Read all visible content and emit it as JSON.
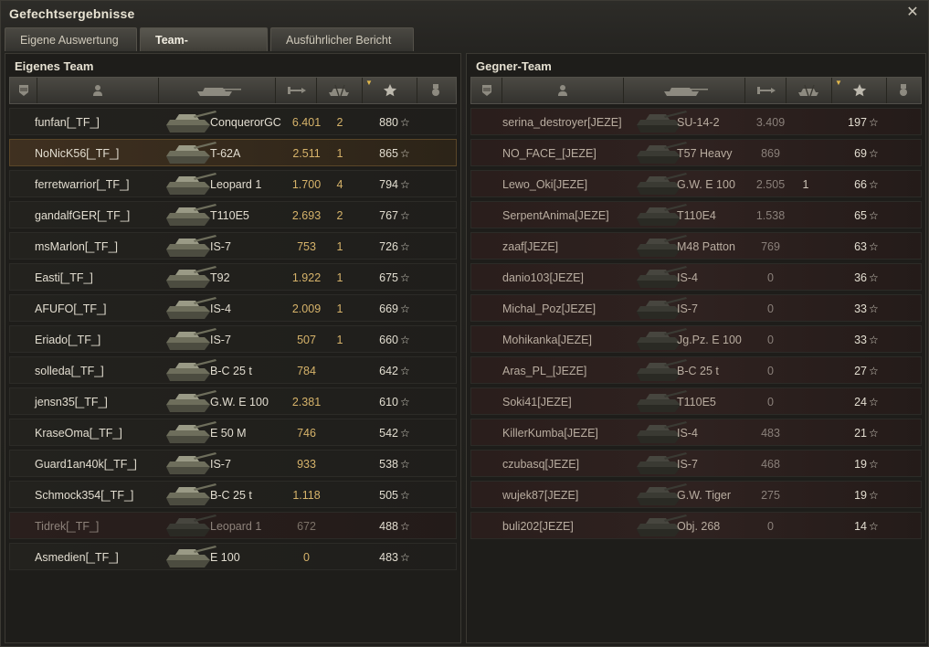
{
  "window": {
    "title": "Gefechtsergebnisse",
    "close_icon": "close-icon"
  },
  "tabs": [
    {
      "label": "Eigene Auswertung",
      "active": false
    },
    {
      "label": "Team-Auswertung",
      "active": true
    },
    {
      "label": "Ausführlicher Bericht",
      "active": false
    }
  ],
  "columns": {
    "icons": [
      "platoon-icon",
      "player-icon",
      "tank-icon",
      "damage-icon",
      "kills-icon",
      "xp-star-icon",
      "medal-icon"
    ],
    "sorted_by": "xp-star-icon"
  },
  "own_team": {
    "title": "Eigenes Team",
    "rows": [
      {
        "name": "funfan[_TF_]",
        "vehicle": "ConquerorGC",
        "damage": "6.401",
        "kills": "2",
        "xp": "880",
        "state": "normal"
      },
      {
        "name": "NoNicK56[_TF_]",
        "vehicle": "T-62A",
        "damage": "2.511",
        "kills": "1",
        "xp": "865",
        "state": "highlight"
      },
      {
        "name": "ferretwarrior[_TF_]",
        "vehicle": "Leopard 1",
        "damage": "1.700",
        "kills": "4",
        "xp": "794",
        "state": "normal"
      },
      {
        "name": "gandalfGER[_TF_]",
        "vehicle": "T110E5",
        "damage": "2.693",
        "kills": "2",
        "xp": "767",
        "state": "normal"
      },
      {
        "name": "msMarlon[_TF_]",
        "vehicle": "IS-7",
        "damage": "753",
        "kills": "1",
        "xp": "726",
        "state": "normal"
      },
      {
        "name": "Easti[_TF_]",
        "vehicle": "T92",
        "damage": "1.922",
        "kills": "1",
        "xp": "675",
        "state": "normal"
      },
      {
        "name": "AFUFO[_TF_]",
        "vehicle": "IS-4",
        "damage": "2.009",
        "kills": "1",
        "xp": "669",
        "state": "normal"
      },
      {
        "name": "Eriado[_TF_]",
        "vehicle": "IS-7",
        "damage": "507",
        "kills": "1",
        "xp": "660",
        "state": "normal"
      },
      {
        "name": "solleda[_TF_]",
        "vehicle": "B-C 25 t",
        "damage": "784",
        "kills": "",
        "xp": "642",
        "state": "normal"
      },
      {
        "name": "jensn35[_TF_]",
        "vehicle": "G.W. E 100",
        "damage": "2.381",
        "kills": "",
        "xp": "610",
        "state": "normal"
      },
      {
        "name": "KraseOma[_TF_]",
        "vehicle": "E 50 M",
        "damage": "746",
        "kills": "",
        "xp": "542",
        "state": "normal"
      },
      {
        "name": "Guard1an40k[_TF_]",
        "vehicle": "IS-7",
        "damage": "933",
        "kills": "",
        "xp": "538",
        "state": "normal"
      },
      {
        "name": "Schmock354[_TF_]",
        "vehicle": "B-C 25 t",
        "damage": "1.118",
        "kills": "",
        "xp": "505",
        "state": "normal"
      },
      {
        "name": "Tidrek[_TF_]",
        "vehicle": "Leopard 1",
        "damage": "672",
        "kills": "",
        "xp": "488",
        "state": "dim"
      },
      {
        "name": "Asmedien[_TF_]",
        "vehicle": "E 100",
        "damage": "0",
        "kills": "",
        "xp": "483",
        "state": "normal"
      }
    ]
  },
  "enemy_team": {
    "title": "Gegner-Team",
    "rows": [
      {
        "name": "serina_destroyer[JEZE]",
        "vehicle": "SU-14-2",
        "damage": "3.409",
        "kills": "",
        "xp": "197",
        "state": "dim"
      },
      {
        "name": "NO_FACE_[JEZE]",
        "vehicle": "T57 Heavy",
        "damage": "869",
        "kills": "",
        "xp": "69",
        "state": "dim"
      },
      {
        "name": "Lewo_Oki[JEZE]",
        "vehicle": "G.W. E 100",
        "damage": "2.505",
        "kills": "1",
        "xp": "66",
        "state": "dim"
      },
      {
        "name": "SerpentAnima[JEZE]",
        "vehicle": "T110E4",
        "damage": "1.538",
        "kills": "",
        "xp": "65",
        "state": "dim"
      },
      {
        "name": "zaaf[JEZE]",
        "vehicle": "M48 Patton",
        "damage": "769",
        "kills": "",
        "xp": "63",
        "state": "dim"
      },
      {
        "name": "danio103[JEZE]",
        "vehicle": "IS-4",
        "damage": "0",
        "kills": "",
        "xp": "36",
        "state": "dim"
      },
      {
        "name": "Michal_Poz[JEZE]",
        "vehicle": "IS-7",
        "damage": "0",
        "kills": "",
        "xp": "33",
        "state": "dim"
      },
      {
        "name": "Mohikanka[JEZE]",
        "vehicle": "Jg.Pz. E 100",
        "damage": "0",
        "kills": "",
        "xp": "33",
        "state": "dim"
      },
      {
        "name": "Aras_PL_[JEZE]",
        "vehicle": "B-C 25 t",
        "damage": "0",
        "kills": "",
        "xp": "27",
        "state": "dim"
      },
      {
        "name": "Soki41[JEZE]",
        "vehicle": "T110E5",
        "damage": "0",
        "kills": "",
        "xp": "24",
        "state": "dim"
      },
      {
        "name": "KillerKumba[JEZE]",
        "vehicle": "IS-4",
        "damage": "483",
        "kills": "",
        "xp": "21",
        "state": "dim"
      },
      {
        "name": "czubasq[JEZE]",
        "vehicle": "IS-7",
        "damage": "468",
        "kills": "",
        "xp": "19",
        "state": "dim"
      },
      {
        "name": "wujek87[JEZE]",
        "vehicle": "G.W. Tiger",
        "damage": "275",
        "kills": "",
        "xp": "19",
        "state": "dim"
      },
      {
        "name": "buli202[JEZE]",
        "vehicle": "Obj. 268",
        "damage": "0",
        "kills": "",
        "xp": "14",
        "state": "dim"
      }
    ]
  },
  "colors": {
    "accent": "#d6b36a",
    "sort_arrow": "#e0b84d",
    "highlight_row": "#3f3020",
    "enemy_row": "#2f2220"
  }
}
